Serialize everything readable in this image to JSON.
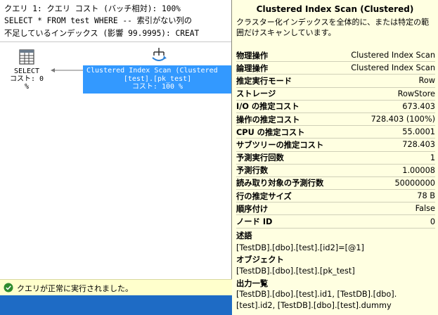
{
  "query_header": {
    "line1": "クエリ 1: クエリ コスト (バッチ相対): 100%",
    "line2": "SELECT * FROM test WHERE -- 索引がない列の",
    "line3": "不足しているインデックス (影響 99.9995): CREAT"
  },
  "select_operator": {
    "label": "SELECT",
    "cost": "コスト: 0 %"
  },
  "scan_operator": {
    "title": "Clustered Index Scan (Clustered",
    "object": "[test].[pk_test]",
    "cost": "コスト: 100 %"
  },
  "tooltip": {
    "title": "Clustered Index Scan (Clustered)",
    "description": "クラスター化インデックスを全体的に、または特定の範囲だけスキャンしています。",
    "rows": [
      {
        "label": "物理操作",
        "value": "Clustered Index Scan"
      },
      {
        "label": "論理操作",
        "value": "Clustered Index Scan"
      },
      {
        "label": "推定実行モード",
        "value": "Row"
      },
      {
        "label": "ストレージ",
        "value": "RowStore"
      },
      {
        "label": "I/O の推定コスト",
        "value": "673.403"
      },
      {
        "label": "操作の推定コスト",
        "value": "728.403 (100%)"
      },
      {
        "label": "CPU の推定コスト",
        "value": "55.0001"
      },
      {
        "label": "サブツリーの推定コスト",
        "value": "728.403"
      },
      {
        "label": "予測実行回数",
        "value": "1"
      },
      {
        "label": "予測行数",
        "value": "1.00008"
      },
      {
        "label": "読み取り対象の予測行数",
        "value": "50000000"
      },
      {
        "label": "行の推定サイズ",
        "value": "78 B"
      },
      {
        "label": "順序付け",
        "value": "False"
      },
      {
        "label": "ノード ID",
        "value": "0"
      }
    ],
    "predicate_label": "述語",
    "predicate_value": "[TestDB].[dbo].[test].[id2]=[@1]",
    "object_label": "オブジェクト",
    "object_value": "[TestDB].[dbo].[test].[pk_test]",
    "output_label": "出力一覧",
    "output_value": "[TestDB].[dbo].[test].id1, [TestDB].[dbo].[test].id2, [TestDB].[dbo].[test].dummy"
  },
  "status": {
    "text": "クエリが正常に実行されました。",
    "color": "#2e8b2e"
  },
  "icons": {
    "select": "table-grid-icon",
    "scan": "clustered-index-scan-icon",
    "status": "check-circle-icon"
  }
}
